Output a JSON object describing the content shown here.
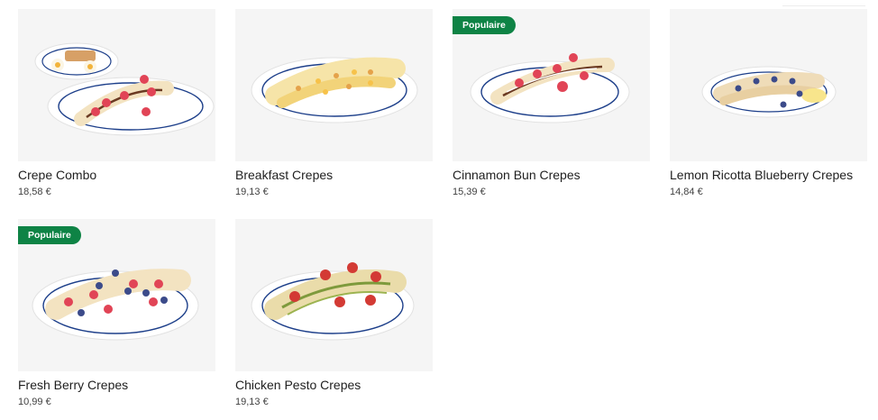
{
  "menu": {
    "items": [
      {
        "name": "Crepe Combo",
        "price": "18,58 €",
        "badge": ""
      },
      {
        "name": "Breakfast Crepes",
        "price": "19,13 €",
        "badge": ""
      },
      {
        "name": "Cinnamon Bun Crepes",
        "price": "15,39 €",
        "badge": "Populaire"
      },
      {
        "name": "Lemon Ricotta Blueberry Crepes",
        "price": "14,84 €",
        "badge": ""
      },
      {
        "name": "Fresh Berry Crepes",
        "price": "10,99 €",
        "badge": "Populaire"
      },
      {
        "name": "Chicken Pesto Crepes",
        "price": "19,13 €",
        "badge": ""
      }
    ]
  },
  "colors": {
    "badge_bg": "#0e8345",
    "thumb_bg": "#f5f5f5",
    "plate_rim": "#1d3f8a"
  }
}
